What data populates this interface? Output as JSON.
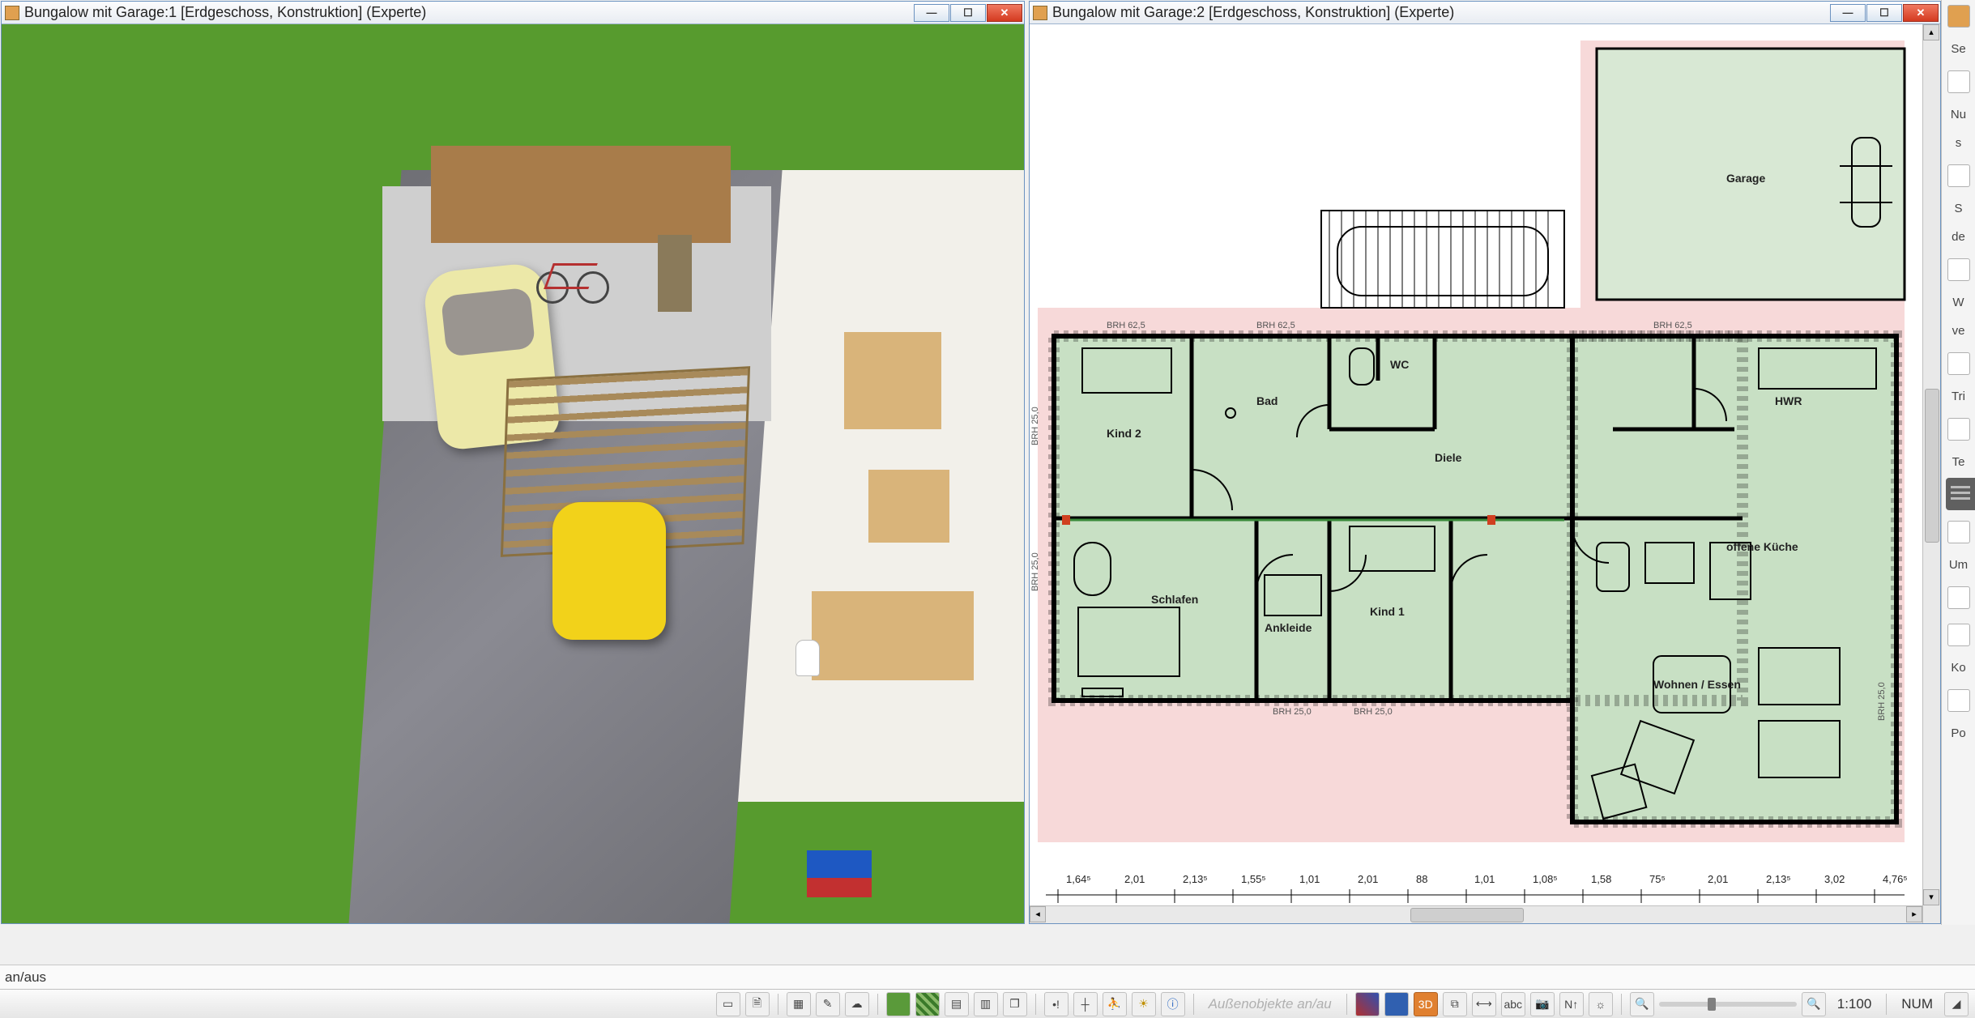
{
  "windows": {
    "w1": {
      "title": "Bungalow mit Garage:1 [Erdgeschoss, Konstruktion] (Experte)"
    },
    "w2": {
      "title": "Bungalow mit Garage:2 [Erdgeschoss, Konstruktion] (Experte)"
    }
  },
  "plan": {
    "rooms": {
      "garage": "Garage",
      "wc": "WC",
      "bad": "Bad",
      "kind2": "Kind 2",
      "hwr": "HWR",
      "diele": "Diele",
      "offene_kueche": "offene Küche",
      "schlafen": "Schlafen",
      "ankleide": "Ankleide",
      "kind1": "Kind 1",
      "wohnen": "Wohnen / Essen"
    },
    "brh": {
      "top1": "BRH 62,5",
      "top2": "BRH 62,5",
      "top3": "BRH 62,5",
      "left1": "BRH 25,0",
      "left2": "BRH 25,0",
      "bot1": "BRH 25,0",
      "bot2": "BRH 25,0",
      "right1": "BRH 25,0"
    },
    "dims_bottom": [
      "1,64⁵",
      "2,01",
      "2,13⁵",
      "1,55⁵",
      "1,01",
      "2,01",
      "88",
      "1,01",
      "1,08⁵",
      "1,58",
      "75⁵",
      "2,01",
      "2,13⁵",
      "3,02",
      "4,76⁵"
    ]
  },
  "right_panel_labels": [
    "Se",
    "Nu",
    "s",
    "S",
    "de",
    "W",
    "ve",
    "Tri",
    "Te",
    "Um",
    "Ko",
    "Po"
  ],
  "status": {
    "left": "an/aus"
  },
  "toolbar": {
    "disabled_text": "Außenobjekte an/au",
    "scale": "1:100",
    "num": "NUM"
  }
}
